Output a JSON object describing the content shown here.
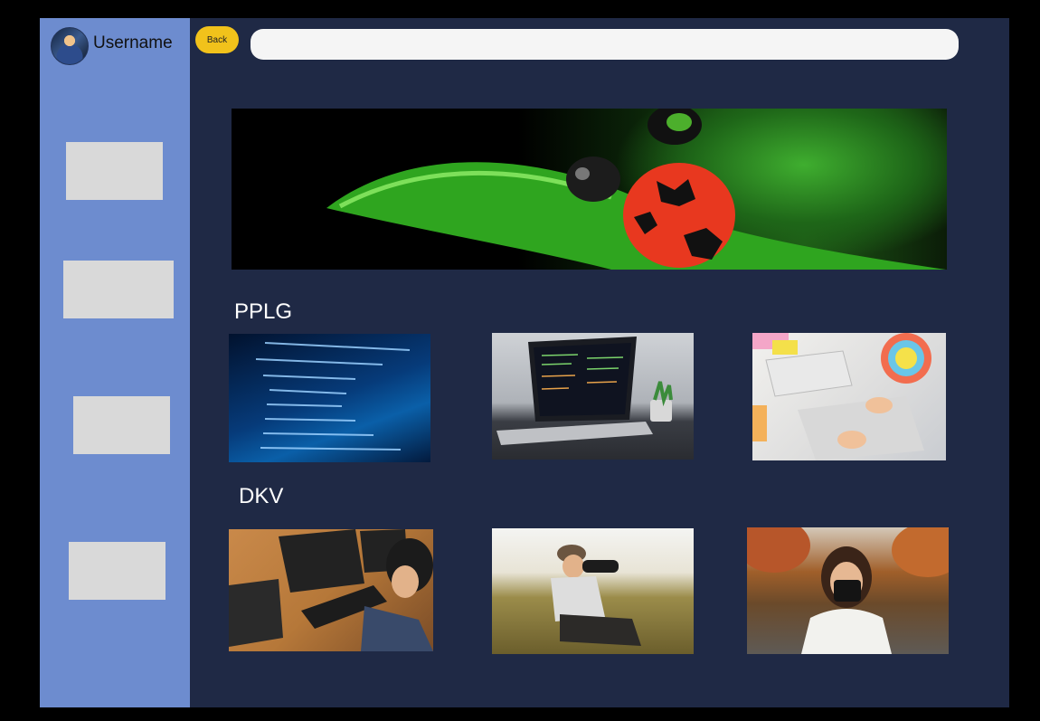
{
  "user": {
    "name": "Username",
    "avatar_icon": "user-avatar"
  },
  "toolbar": {
    "back_label": "Back",
    "search_placeholder": ""
  },
  "banner": {
    "image": "ladybug-on-leaf"
  },
  "sections": [
    {
      "title": "PPLG",
      "images": [
        "code-on-screen",
        "laptop-with-code",
        "graphic-design-desk"
      ]
    },
    {
      "title": "DKV",
      "images": [
        "programmer-at-desk",
        "photographer-in-field",
        "photographer-woman-camera"
      ]
    }
  ],
  "colors": {
    "background": "#1f2945",
    "sidebar": "#6d8ccf",
    "accent": "#f1c21b",
    "placeholder": "#d9d9d9"
  }
}
